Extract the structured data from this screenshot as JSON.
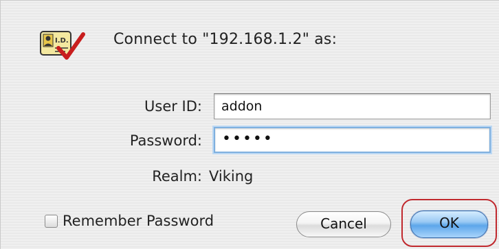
{
  "dialog": {
    "title": "Connect to \"192.168.1.2\" as:",
    "icon": "id-card-check-icon",
    "icon_text": "I.D."
  },
  "form": {
    "user_id_label": "User ID:",
    "user_id_value": "addon",
    "password_label": "Password:",
    "password_value": "•••••",
    "realm_label": "Realm:",
    "realm_value": "Viking"
  },
  "options": {
    "remember_password_label": "Remember Password",
    "remember_password_checked": false
  },
  "buttons": {
    "cancel_label": "Cancel",
    "ok_label": "OK"
  },
  "colors": {
    "highlight_ring": "#c0282d",
    "default_button": "#5da6ea",
    "focus_ring": "#7fb0df"
  }
}
